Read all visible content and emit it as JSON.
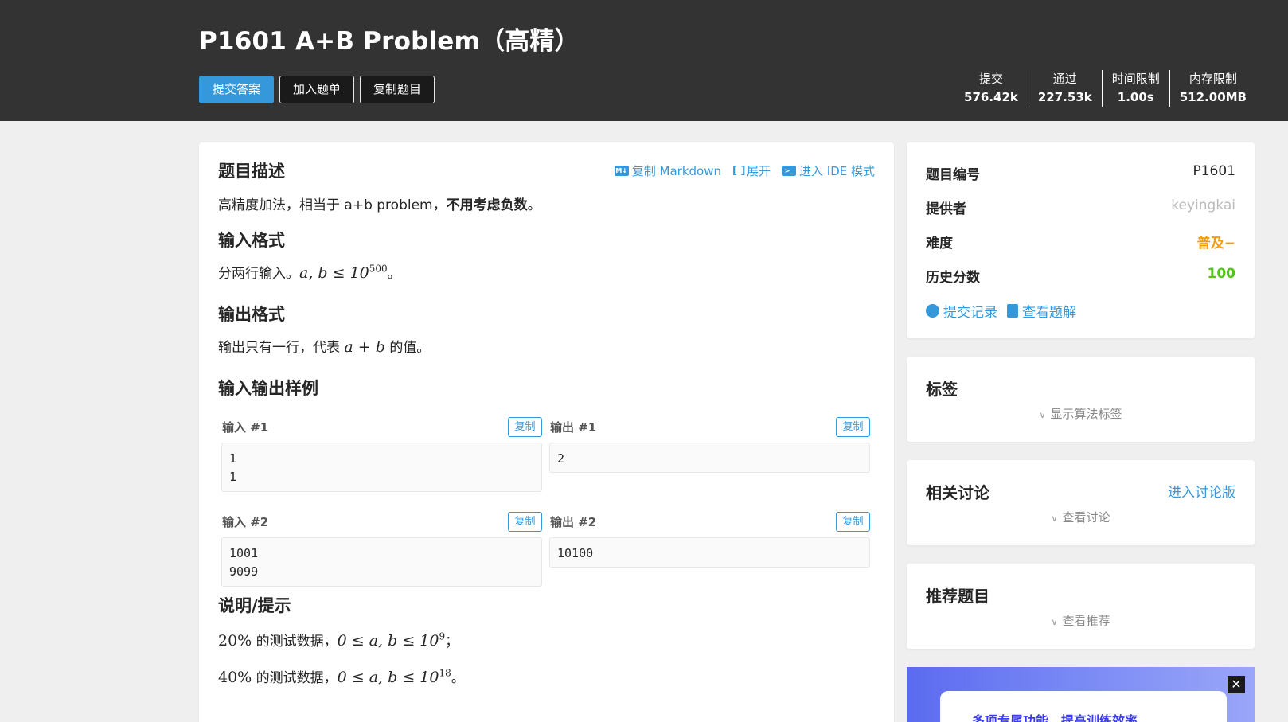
{
  "header": {
    "title": "P1601 A+B Problem（高精）",
    "buttons": {
      "submit": "提交答案",
      "add_list": "加入题单",
      "copy": "复制题目"
    },
    "stats": [
      {
        "label": "提交",
        "value": "576.42k"
      },
      {
        "label": "通过",
        "value": "227.53k"
      },
      {
        "label": "时间限制",
        "value": "1.00s"
      },
      {
        "label": "内存限制",
        "value": "512.00MB"
      }
    ]
  },
  "main": {
    "tools": {
      "copy_md": "复制 Markdown",
      "expand": "展开",
      "ide": "进入 IDE 模式",
      "md_icon": "M↓",
      "expand_icon": "[ ]"
    },
    "desc_title": "题目描述",
    "desc_text": "高精度加法，相当于 a+b problem，",
    "desc_bold": "不用考虑负数",
    "desc_end": "。",
    "input_title": "输入格式",
    "input_text": "分两行输入。",
    "input_math": "a, b ≤ 10",
    "input_exp": "500",
    "input_end": "。",
    "output_title": "输出格式",
    "output_text": "输出只有一行，代表",
    "output_math": "a + b",
    "output_end": "的值。",
    "samples_title": "输入输出样例",
    "copy_label": "复制",
    "samples": [
      {
        "in_label": "输入 #1",
        "out_label": "输出 #1",
        "input": "1\n1",
        "output": "2"
      },
      {
        "in_label": "输入 #2",
        "out_label": "输出 #2",
        "input": "1001\n9099",
        "output": "10100"
      }
    ],
    "hint_title": "说明/提示",
    "hints": [
      {
        "pct": "20%",
        "text": " 的测试数据，",
        "math": "0 ≤ a, b ≤ 10",
        "exp": "9",
        "end": "；"
      },
      {
        "pct": "40%",
        "text": " 的测试数据，",
        "math": "0 ≤ a, b ≤ 10",
        "exp": "18",
        "end": "。"
      }
    ]
  },
  "sidebar": {
    "info": [
      {
        "label": "题目编号",
        "value": "P1601",
        "color": "#262626"
      },
      {
        "label": "提供者",
        "value": "keyingkai",
        "color": "#bbbbbb"
      },
      {
        "label": "难度",
        "value": "普及−",
        "color": "#f39c11"
      },
      {
        "label": "历史分数",
        "value": "100",
        "color": "#52c41a"
      }
    ],
    "links": {
      "records": "提交记录",
      "solutions": "查看题解"
    },
    "tags": {
      "title": "标签",
      "toggle": "显示算法标签"
    },
    "discuss": {
      "title": "相关讨论",
      "link": "进入讨论版",
      "toggle": "查看讨论"
    },
    "recommend": {
      "title": "推荐题目",
      "toggle": "查看推荐"
    },
    "ad": {
      "text": "多项专属功能，提高训练效率",
      "close": "✕"
    }
  },
  "colors": {
    "accent": "#3498db",
    "header_bg": "#333333"
  }
}
